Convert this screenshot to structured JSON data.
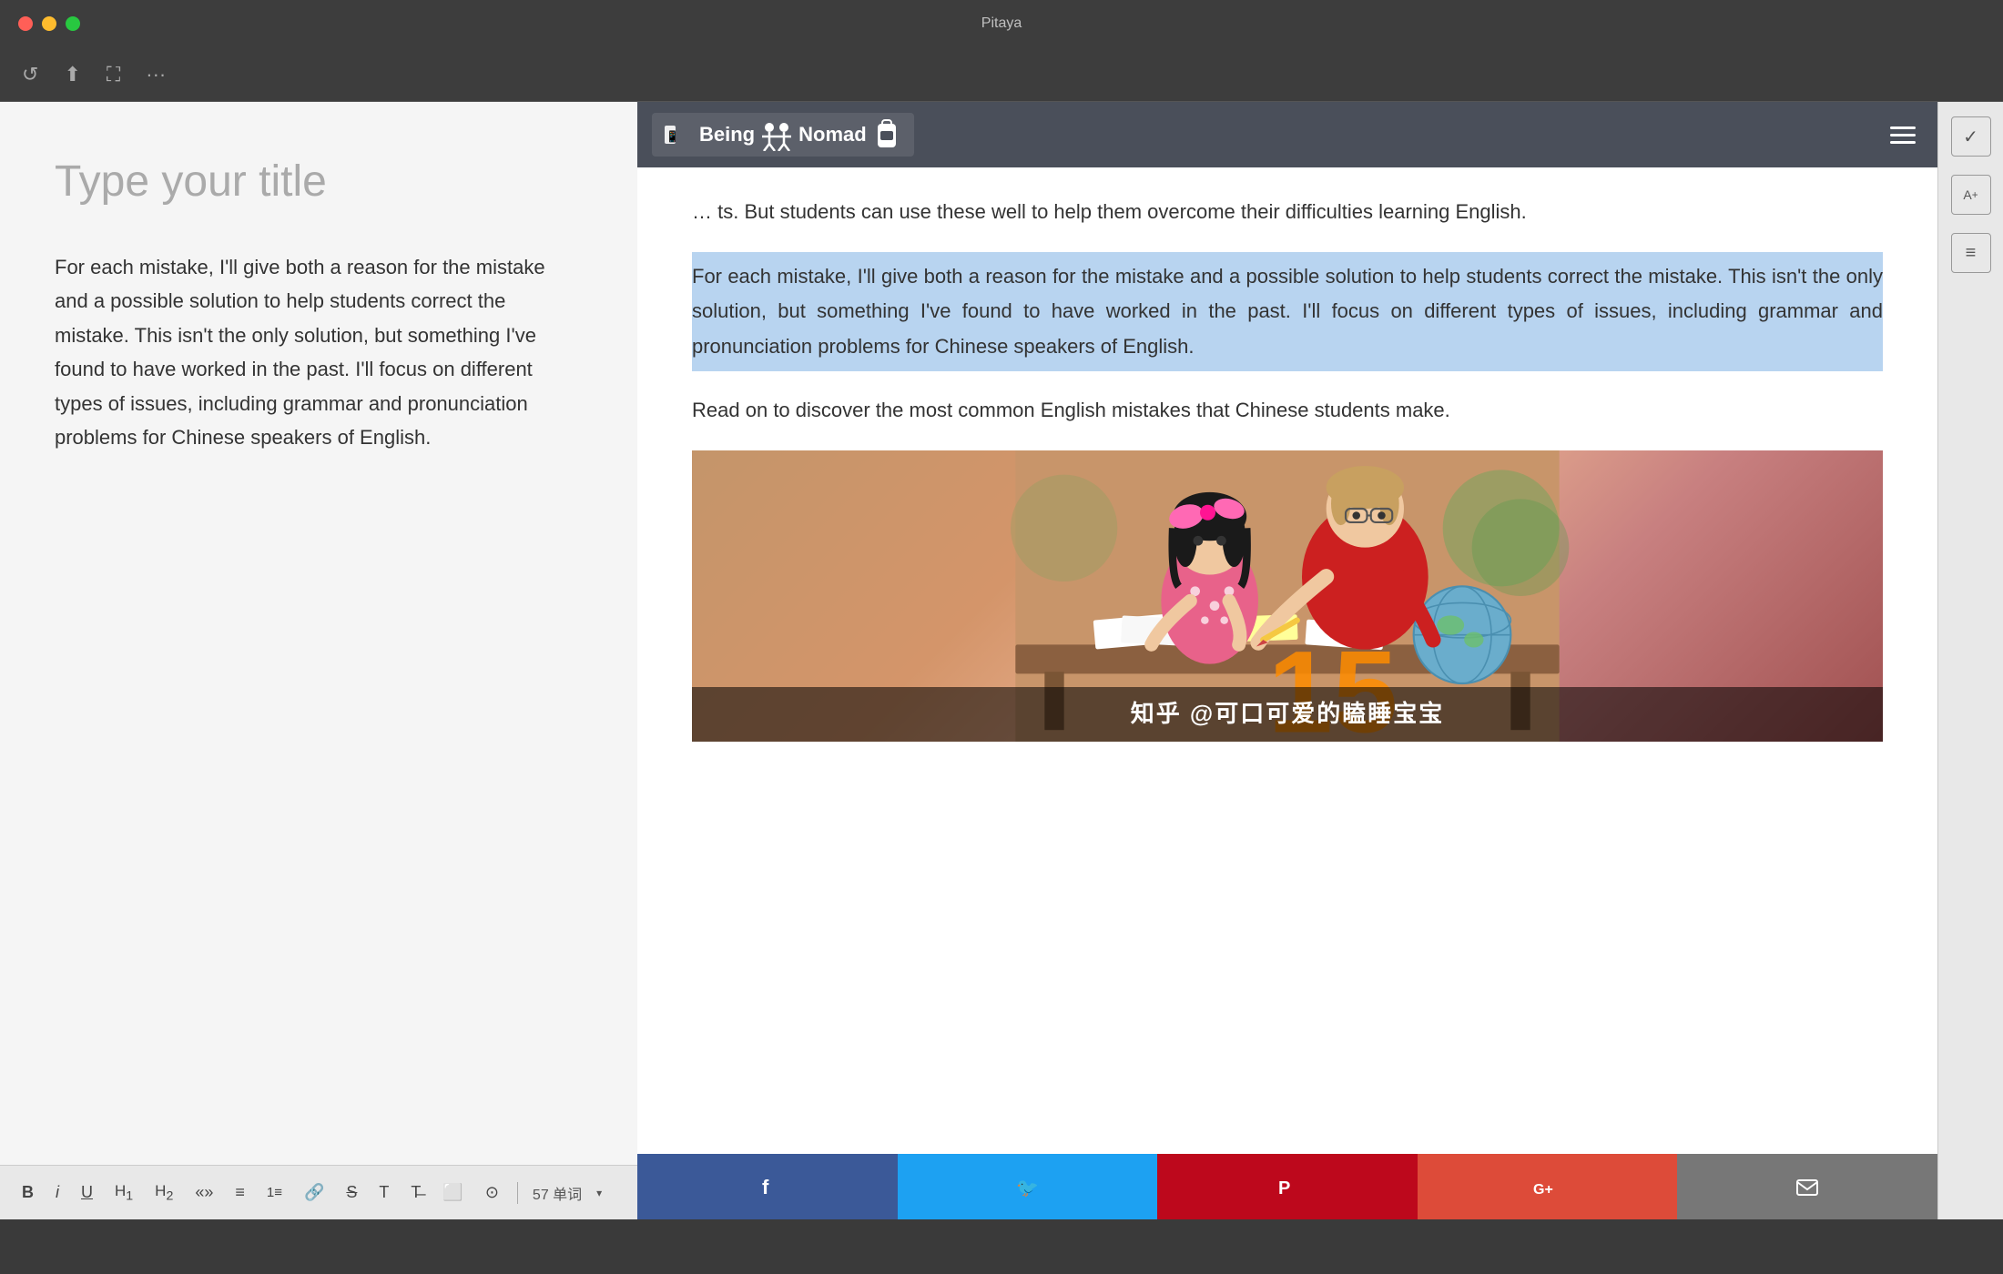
{
  "window": {
    "title": "Pitaya"
  },
  "toolbar": {
    "icons": [
      "↺",
      "⬆",
      "⛶",
      "···"
    ]
  },
  "editor": {
    "title_placeholder": "Type your title",
    "content": "For each mistake, I'll give both a reason for the mistake and a possible solution to help students correct the mistake. This isn't the only solution, but something I've found to have worked in the past. I'll focus on different types of issues, including grammar and pronunciation problems for Chinese speakers of English."
  },
  "browser": {
    "logo_text": "Being",
    "logo_nomad": "Nomad",
    "article_para1": "… ts. But students can use these well to help them overcome their difficulties learning English.",
    "article_para2": "For each mistake, I'll give both a reason for the mistake and a possible solution to help students correct the mistake. This isn't the only solution, but something I've found to have worked in the past. I'll focus on different types of issues, including grammar and pronunciation problems for Chinese speakers of English.",
    "article_para3": "Read on to discover the most common English mistakes that Chinese students make.",
    "watermark": "知乎 @可口可爱的瞌睡宝宝"
  },
  "sidebar_icons": [
    "✓",
    "A+",
    "≡"
  ],
  "bottom_toolbar": {
    "word_count": "57 单词",
    "icons": {
      "bold": "B",
      "italic": "i",
      "underline": "U",
      "h1": "H₁",
      "h2": "H₂",
      "quote": "«»",
      "list_bullet": "≡",
      "list_number": "≡",
      "link": "🔗",
      "strikethrough": "S",
      "type": "T",
      "clear": "T̶",
      "image": "⬜",
      "more": "⊙"
    }
  },
  "social": {
    "buttons": [
      "f",
      "🐦",
      "P",
      "G+",
      "✉"
    ]
  }
}
